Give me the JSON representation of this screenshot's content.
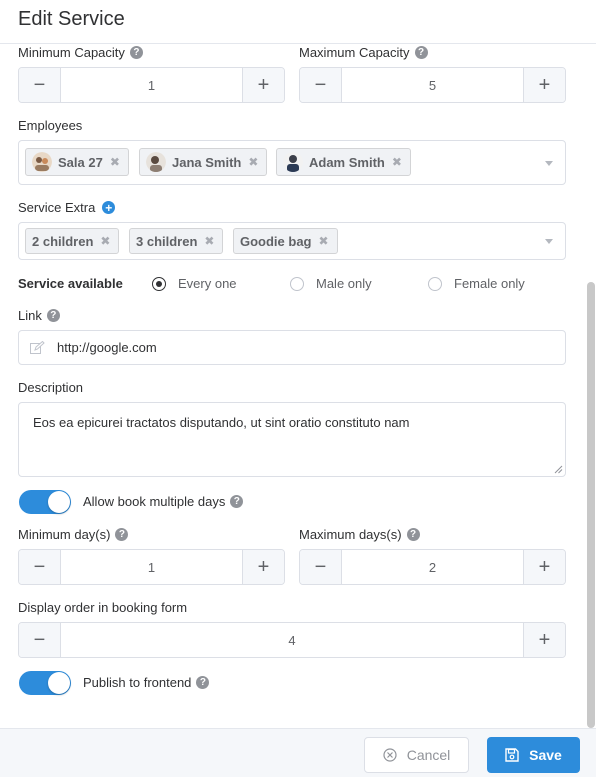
{
  "header": {
    "title": "Edit Service"
  },
  "capacity": {
    "min_label": "Minimum Capacity",
    "min_value": "1",
    "max_label": "Maximum Capacity",
    "max_value": "5"
  },
  "employees": {
    "label": "Employees",
    "tags": [
      "Sala 27",
      "Jana Smith",
      "Adam Smith"
    ]
  },
  "extras": {
    "label": "Service Extra",
    "tags": [
      "2 children",
      "3 children",
      "Goodie bag"
    ]
  },
  "availability": {
    "label": "Service available",
    "options": [
      "Every one",
      "Male only",
      "Female only"
    ],
    "selected": "Every one"
  },
  "link": {
    "label": "Link",
    "value": "http://google.com"
  },
  "description": {
    "label": "Description",
    "value": "Eos ea epicurei tractatos disputando, ut sint oratio constituto nam"
  },
  "multi_day": {
    "label": "Allow book multiple days",
    "enabled": true
  },
  "days": {
    "min_label": "Minimum day(s)",
    "min_value": "1",
    "max_label": "Maximum days(s)",
    "max_value": "2"
  },
  "display_order": {
    "label": "Display order in booking form",
    "value": "4"
  },
  "publish": {
    "label": "Publish to frontend",
    "enabled": true
  },
  "footer": {
    "cancel_label": "Cancel",
    "save_label": "Save"
  },
  "colors": {
    "accent": "#2d8cdb",
    "border": "#dcdfe6",
    "muted": "#909399"
  }
}
